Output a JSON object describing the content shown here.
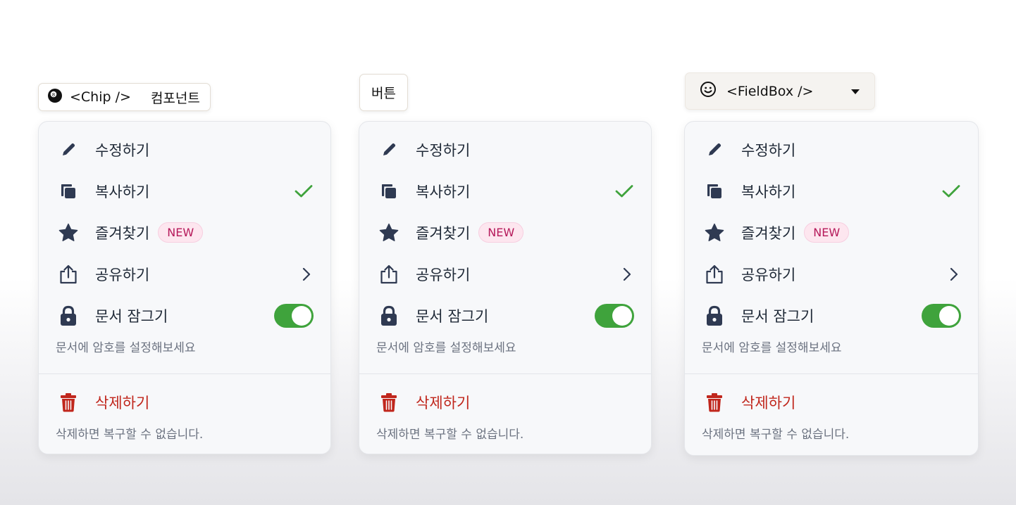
{
  "headers": {
    "chip": {
      "icon": "eight-ball-icon",
      "code_label": "<Chip />",
      "suffix": "컴포넌트"
    },
    "button": {
      "label": "버튼"
    },
    "fieldbox": {
      "icon": "smiley-icon",
      "label": "<FieldBox />",
      "caret": "caret-down-icon"
    }
  },
  "menu": {
    "edit": {
      "label": "수정하기",
      "icon": "pencil-icon"
    },
    "copy": {
      "label": "복사하기",
      "icon": "copy-icon",
      "checked": true
    },
    "favorite": {
      "label": "즐겨찾기",
      "icon": "star-icon",
      "badge": "NEW"
    },
    "share": {
      "label": "공유하기",
      "icon": "share-icon"
    },
    "lock": {
      "label": "문서 잠그기",
      "icon": "lock-icon",
      "toggle_on": true,
      "helper": "문서에 암호를 설정해보세요"
    },
    "delete": {
      "label": "삭제하기",
      "icon": "trash-icon",
      "helper": "삭제하면 복구할 수 없습니다."
    }
  },
  "colors": {
    "accent_green": "#3fa33c",
    "danger_red": "#c0261c",
    "badge_pink": "#fde6ef",
    "icon_navy": "#2f3a52"
  }
}
